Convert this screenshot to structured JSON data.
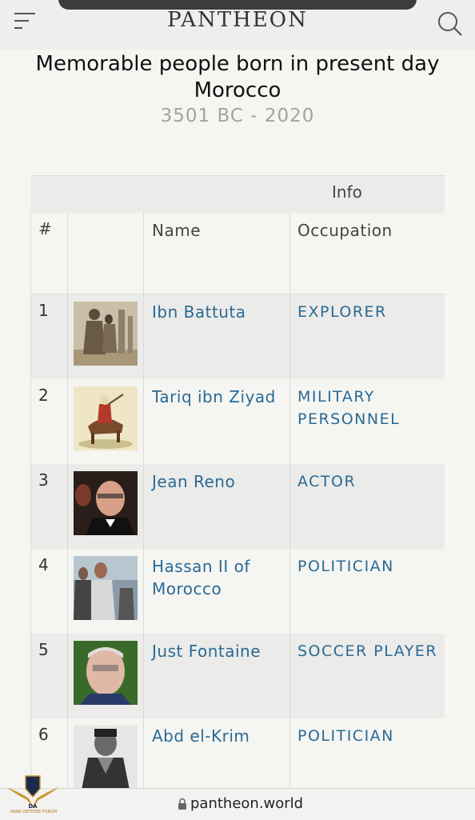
{
  "header": {
    "logo": "PANTHEON",
    "menu_icon": "hamburger-menu-icon",
    "search_icon": "search-icon"
  },
  "page": {
    "title": "Memorable people born in present day Morocco",
    "range": "3501 BC - 2020"
  },
  "table": {
    "group_header": "Info",
    "columns": {
      "rank": "#",
      "photo": "",
      "name": "Name",
      "occupation": "Occupation"
    },
    "rows": [
      {
        "rank": "1",
        "name": "Ibn Battuta",
        "occupation": "EXPLORER"
      },
      {
        "rank": "2",
        "name": "Tariq ibn Ziyad",
        "occupation": "MILITARY PERSONNEL"
      },
      {
        "rank": "3",
        "name": "Jean Reno",
        "occupation": "ACTOR"
      },
      {
        "rank": "4",
        "name": "Hassan II of Morocco",
        "occupation": "POLITICIAN"
      },
      {
        "rank": "5",
        "name": "Just Fontaine",
        "occupation": "SOCCER PLAYER"
      },
      {
        "rank": "6",
        "name": "Abd el-Krim",
        "occupation": "POLITICIAN"
      }
    ]
  },
  "browser": {
    "url": "pantheon.world"
  },
  "watermark": {
    "short": "DA",
    "name": "ARAB DEFENSE FORUM"
  },
  "colors": {
    "link": "#2a6a95",
    "muted": "#a7a39a",
    "stripe": "#ebebe9"
  }
}
